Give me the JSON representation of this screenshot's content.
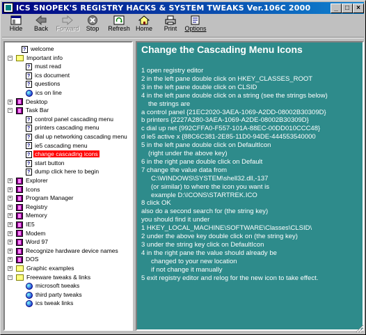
{
  "window": {
    "title": "ICS SNOPEK'S REGISTRY HACKS & SYSTEM TWEAKS    Ver.106C 2000",
    "controls": [
      "_",
      "□",
      "×"
    ]
  },
  "toolbar": {
    "hide": "Hide",
    "back": "Back",
    "forward": "Forward",
    "stop": "Stop",
    "refresh": "Refresh",
    "home": "Home",
    "print": "Print",
    "options": "Options"
  },
  "tree": [
    {
      "label": "welcome",
      "icon": "doc-icon",
      "level": 1
    },
    {
      "label": "Important info",
      "icon": "folder-icon",
      "level": 0,
      "expander": "−"
    },
    {
      "label": "must read",
      "icon": "doc-icon",
      "level": 2
    },
    {
      "label": "ics document",
      "icon": "doc-icon",
      "level": 2
    },
    {
      "label": "questions",
      "icon": "doc-icon",
      "level": 2
    },
    {
      "label": "ics on line",
      "icon": "globe-icon",
      "level": 2
    },
    {
      "label": "Desktop",
      "icon": "book-icon",
      "level": 0,
      "expander": "+"
    },
    {
      "label": "Task Bar",
      "icon": "book-icon",
      "level": 0,
      "expander": "−"
    },
    {
      "label": "control panel cascading menu",
      "icon": "doc-icon",
      "level": 2
    },
    {
      "label": "printers cascading menu",
      "icon": "doc-icon",
      "level": 2
    },
    {
      "label": "dial up networking cascading menu",
      "icon": "doc-icon",
      "level": 2
    },
    {
      "label": "ie5 cascading menu",
      "icon": "doc-icon",
      "level": 2
    },
    {
      "label": "change cascading icons",
      "icon": "doc-icon",
      "level": 2,
      "selected": true
    },
    {
      "label": "start button",
      "icon": "doc-icon",
      "level": 2
    },
    {
      "label": "dump click here to begin",
      "icon": "doc-icon",
      "level": 2
    },
    {
      "label": "Explorer",
      "icon": "book-icon",
      "level": 0,
      "expander": "+"
    },
    {
      "label": "Icons",
      "icon": "book-icon",
      "level": 0,
      "expander": "+"
    },
    {
      "label": "Program Manager",
      "icon": "book-icon",
      "level": 0,
      "expander": "+"
    },
    {
      "label": "Registry",
      "icon": "book-icon",
      "level": 0,
      "expander": "+"
    },
    {
      "label": "Memory",
      "icon": "book-icon",
      "level": 0,
      "expander": "+"
    },
    {
      "label": "IE5",
      "icon": "book-icon",
      "level": 0,
      "expander": "+"
    },
    {
      "label": "Modem",
      "icon": "book-icon",
      "level": 0,
      "expander": "+"
    },
    {
      "label": "Word 97",
      "icon": "book-icon",
      "level": 0,
      "expander": "+"
    },
    {
      "label": "Recognize hardware device names",
      "icon": "book-icon",
      "level": 0,
      "expander": "+"
    },
    {
      "label": "DOS",
      "icon": "book-icon",
      "level": 0,
      "expander": "+"
    },
    {
      "label": "Graphic examples",
      "icon": "folder-icon",
      "level": 0,
      "expander": "+"
    },
    {
      "label": "Freeware tweaks & links",
      "icon": "folder-icon",
      "level": 0,
      "expander": "−"
    },
    {
      "label": "microsoft tweaks",
      "icon": "globe-icon",
      "level": 2
    },
    {
      "label": "third party tweaks",
      "icon": "globe-icon",
      "level": 2
    },
    {
      "label": "ics tweak links",
      "icon": "globe-icon",
      "level": 2
    }
  ],
  "content": {
    "heading": "Change the Cascading Menu Icons",
    "lines": [
      {
        "text": "1 open registry editor",
        "indent": 0
      },
      {
        "text": "2 in the left pane double click on HKEY_CLASSES_ROOT",
        "indent": 0
      },
      {
        "text": "3 in the left pane double click on CLSID",
        "indent": 0
      },
      {
        "text": "4 in the left pane double click on a string (see the strings below)",
        "indent": 0
      },
      {
        "text": "the strings are",
        "indent": 1
      },
      {
        "text": "a control panel {21EC2020-3AEA-1069-A2DD-08002B30309D}",
        "indent": 0
      },
      {
        "text": "b printers {2227A280-3AEA-1069-A2DE-08002B30309D}",
        "indent": 0
      },
      {
        "text": "c dial up net {992CFFA0-F557-101A-88EC-00DD010CCC48}",
        "indent": 0
      },
      {
        "text": "d ie5 active x {88C6C381-2E85-11D0-94DE-444553540000",
        "indent": 0
      },
      {
        "text": "5 in the left pane double click on DefaultIcon",
        "indent": 0
      },
      {
        "text": "(right under the above key)",
        "indent": 1
      },
      {
        "text": "6 in the right pane double click on Default",
        "indent": 0
      },
      {
        "text": "7 change the value data from",
        "indent": 0
      },
      {
        "text": "C:\\WINDOWS\\SYSTEM\\shell32.dll,-137",
        "indent": 2
      },
      {
        "text": "(or similar) to where the icon you want is",
        "indent": 2
      },
      {
        "text": "example D:\\ICONS\\STARTREK.ICO",
        "indent": 2
      },
      {
        "text": "8 click OK",
        "indent": 0
      },
      {
        "text": "also do a second search for (the string key)",
        "indent": 0
      },
      {
        "text": "you should find it under",
        "indent": 0
      },
      {
        "text": "1 HKEY_LOCAL_MACHINE\\SOFTWARE\\Classes\\CLSID\\",
        "indent": 0
      },
      {
        "text": "2 under the above key double click on (the string key)",
        "indent": 0
      },
      {
        "text": "3 under the string key click on DefaultIcon",
        "indent": 0
      },
      {
        "text": "4 in the right pane the value should already be",
        "indent": 0
      },
      {
        "text": "changed to your new location",
        "indent": 2
      },
      {
        "text": "if not change it manually",
        "indent": 2
      },
      {
        "text": "5 exit registry editor and relog for the new icon to take effect.",
        "indent": 0
      }
    ]
  },
  "colors": {
    "title_start": "#000080",
    "title_end": "#1084d0",
    "content_bg": "#2e8b8b",
    "selection": "#ff0000"
  }
}
